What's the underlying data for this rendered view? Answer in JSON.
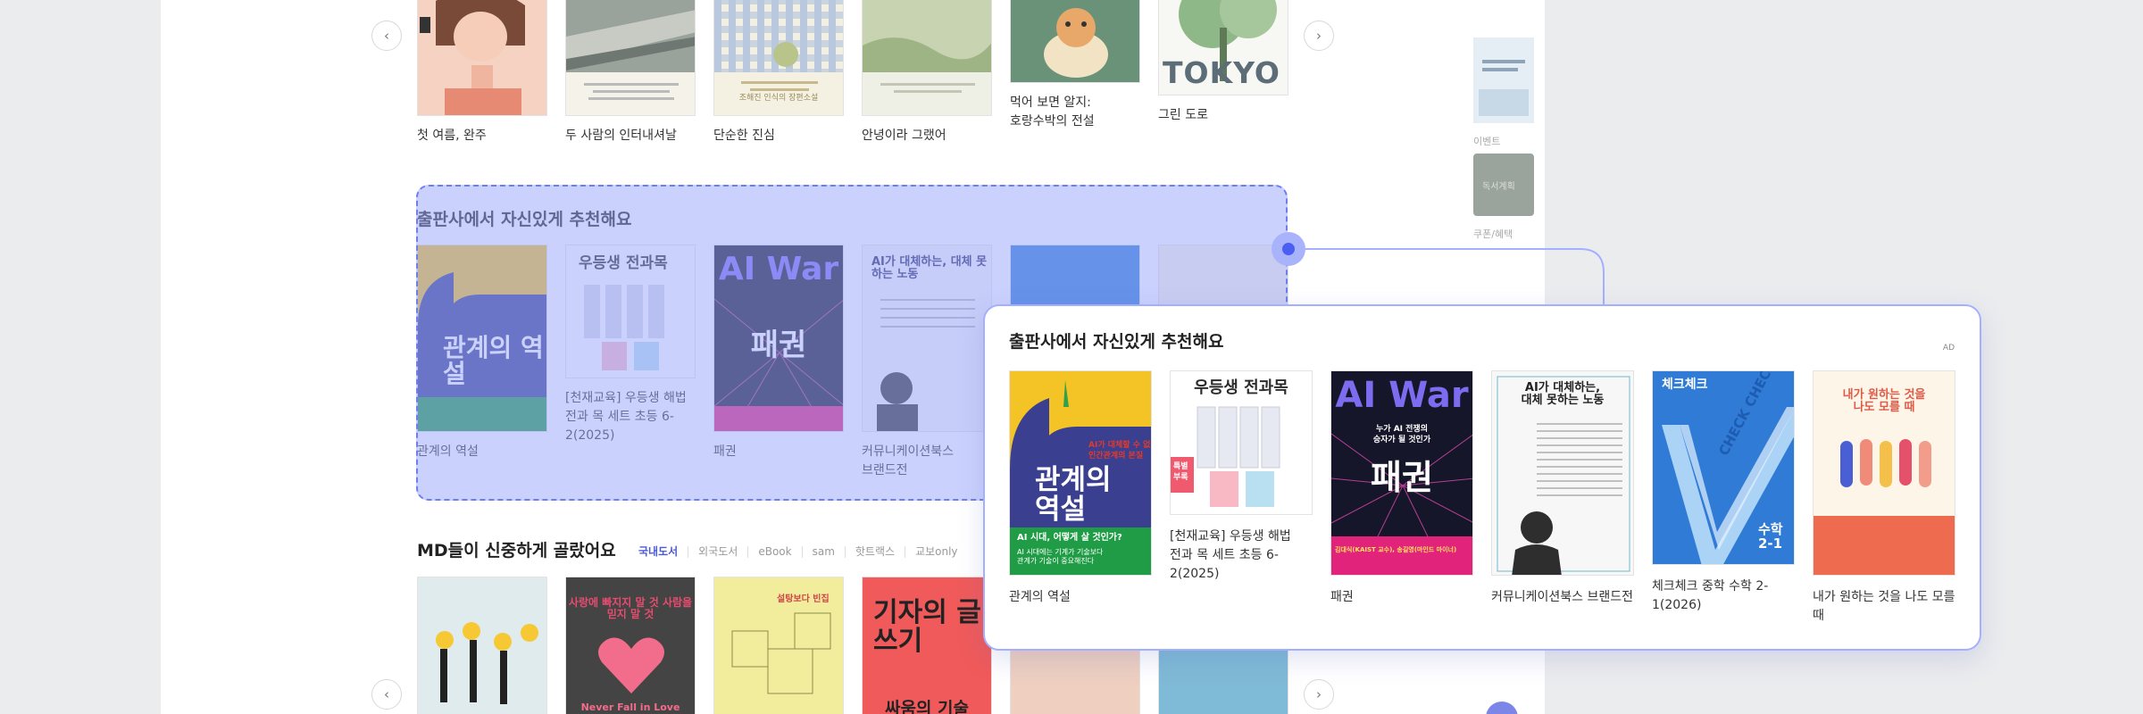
{
  "top_row": {
    "books": [
      {
        "title": "첫 여름, 완주"
      },
      {
        "title": "두 사람의 인터내셔날"
      },
      {
        "title": "단순한 진심"
      },
      {
        "title": "안녕이라 그랬어"
      },
      {
        "title": "먹어 보면 알지: 호랑수박의 전설"
      },
      {
        "title": "그린 도로"
      }
    ],
    "cover_texts": {
      "tokyo": "TOKYO",
      "calm": "조해진 인식의 장편소설"
    }
  },
  "side_rail": {
    "labels": [
      "이벤트",
      "쿠폰/혜택"
    ],
    "thumb_text": "독서계획"
  },
  "publisher_section": {
    "title": "출판사에서 자신있게 추천해요",
    "ad": "AD",
    "books": [
      {
        "title": "관계의 역설"
      },
      {
        "title": "[천재교육] 우등생 해법 전과 목 세트 초등 6-2(2025)"
      },
      {
        "title": "패권"
      },
      {
        "title": "커뮤니케이션북스 브랜드전"
      },
      {
        "title": "체크체크 중학 수학 2-1(2026)"
      },
      {
        "title": "내가 원하는 것을 나도 모를 때"
      }
    ],
    "covers": {
      "book1_main": "관계의\n역설",
      "book1_top": "AI가 대체할 수 없는\n인간관계의 본질",
      "book1_bottom": "AI 시대, 어떻게 살 것인가?",
      "book1_bottom2": "AI 시대에는 기계가 기술보다\n관계가 기술이 중요해진다",
      "book2_main": "우등생 전과목",
      "book2_tag": "특별\n부록",
      "book3_main": "AI War",
      "book3_sub": "누가 AI 전쟁의\n승자가 될 것인가",
      "book3_kor": "패권",
      "book3_authors": "김대식(KAIST 교수), 송길영(마인드 마이너)",
      "book4_main": "AI가 대체하는,\n대체 못하는 노동",
      "book5_top": "체크체크",
      "book5_diag": "CHECK CHECK",
      "book5_grade": "수학\n2-1",
      "book6_main": "내가 원하는 것을\n나도 모를 때"
    }
  },
  "md_section": {
    "title": "MD들이 신중하게 골랐어요",
    "tabs": [
      "국내도서",
      "외국도서",
      "eBook",
      "sam",
      "핫트랙스",
      "교보only"
    ],
    "cover_texts": {
      "b2_main": "사랑에 빠지지 말 것\n사람을 믿지 말 것",
      "b2_bottom": "Never Fall in Love",
      "b3_top": "설탕보다 빈집",
      "b4_main": "기자의\n글쓰기",
      "b4_bottom": "싸움의 기술"
    }
  },
  "nav": {
    "prev": "‹",
    "next": "›"
  },
  "colors": {
    "accent": "#4a5ff0",
    "overlay": "#99a6fb",
    "popup_border": "#a5afff"
  }
}
